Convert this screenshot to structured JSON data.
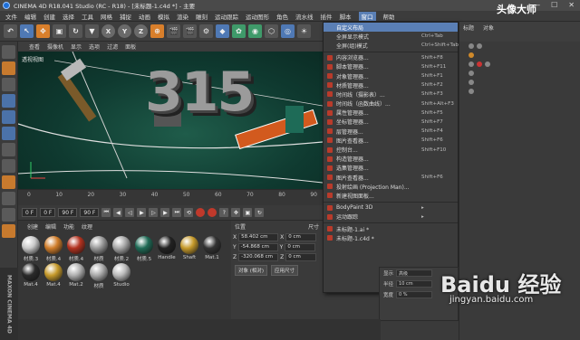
{
  "titlebar": {
    "title": "CINEMA 4D R18.041 Studio (RC - R18) - [未标题-1.c4d *] - 主要",
    "min": "—",
    "max": "☐",
    "close": "✕"
  },
  "menubar": {
    "items": [
      "文件",
      "编辑",
      "创建",
      "选择",
      "工具",
      "网格",
      "捕捉",
      "动画",
      "模拟",
      "渲染",
      "雕刻",
      "运动跟踪",
      "运动图形",
      "角色",
      "流水线",
      "插件",
      "脚本",
      "窗口",
      "帮助"
    ],
    "active_index": 17
  },
  "toolbar": {
    "axes": [
      "X",
      "Y",
      "Z"
    ]
  },
  "viewport": {
    "menu": [
      "查看",
      "摄像机",
      "显示",
      "选项",
      "过滤",
      "面板"
    ],
    "label": "透视视图",
    "scene_text": "315"
  },
  "timeline": {
    "ticks": [
      "0",
      "10",
      "20",
      "30",
      "40",
      "50",
      "60",
      "70",
      "80",
      "90"
    ]
  },
  "playbar": {
    "start": "0 F",
    "current": "0 F",
    "end": "90 F",
    "end2": "90 F"
  },
  "materials": {
    "menu": [
      "创建",
      "编辑",
      "功能",
      "纹理"
    ],
    "items": [
      {
        "name": "材质.3",
        "color": "#c9c9c9"
      },
      {
        "name": "材质.4",
        "color": "#d07d2a"
      },
      {
        "name": "材质.4",
        "color": "#b3321f"
      },
      {
        "name": "材质",
        "color": "#9a9a9a"
      },
      {
        "name": "材质.2",
        "color": "#a8a8a8"
      },
      {
        "name": "材质.5",
        "color": "#1f6b56"
      },
      {
        "name": "Handle",
        "color": "#222222"
      },
      {
        "name": "Shaft",
        "color": "#c69a2b"
      },
      {
        "name": "Mat.1",
        "color": "#333333"
      },
      {
        "name": "Mat.4",
        "color": "#2a2a2a"
      },
      {
        "name": "Mat.4",
        "color": "#c69a2b"
      },
      {
        "name": "Mat.2",
        "color": "#b0b0b0"
      },
      {
        "name": "材质",
        "color": "#aaaaaa"
      },
      {
        "name": "Studio",
        "color": "#bbbbbb"
      }
    ]
  },
  "coords": {
    "head": [
      "位置",
      "尺寸"
    ],
    "rows": [
      {
        "axis": "X",
        "pos": "58.402 cm",
        "axis2": "X",
        "size": "0 cm"
      },
      {
        "axis": "Y",
        "pos": "-54.868 cm",
        "axis2": "Y",
        "size": "0 cm"
      },
      {
        "axis": "Z",
        "pos": "-320.068 cm",
        "axis2": "Z",
        "size": "0 cm"
      }
    ],
    "mode": "对象 (相对)",
    "apply": "应用尺寸"
  },
  "window_menu": {
    "items": [
      {
        "label": "自定义布局",
        "shortcut": "",
        "highlight": true
      },
      {
        "label": "全屏显示模式",
        "shortcut": "Ctrl+Tab"
      },
      {
        "label": "全屏(组)模式",
        "shortcut": "Ctrl+Shift+Tab"
      },
      {
        "label": "内容浏览器...",
        "shortcut": "Shift+F8"
      },
      {
        "label": "脚本管理器...",
        "shortcut": "Shift+F11"
      },
      {
        "label": "对象管理器...",
        "shortcut": "Shift+F1"
      },
      {
        "label": "材质管理器...",
        "shortcut": "Shift+F2"
      },
      {
        "label": "时间线（摄影表）...",
        "shortcut": "Shift+F3"
      },
      {
        "label": "时间线（函数曲线）...",
        "shortcut": "Shift+Alt+F3"
      },
      {
        "label": "属性管理器...",
        "shortcut": "Shift+F5"
      },
      {
        "label": "坐标管理器...",
        "shortcut": "Shift+F7"
      },
      {
        "label": "层管理器...",
        "shortcut": "Shift+F4"
      },
      {
        "label": "图片查看器...",
        "shortcut": "Shift+F6"
      },
      {
        "label": "控制台...",
        "shortcut": "Shift+F10"
      },
      {
        "label": "构造管理器...",
        "shortcut": ""
      },
      {
        "label": "选集管理器...",
        "shortcut": ""
      },
      {
        "label": "图片查看器...",
        "shortcut": "Shift+F6"
      },
      {
        "label": "投射绘画 (Projection Man)...",
        "shortcut": ""
      },
      {
        "label": "新建视图面板...",
        "shortcut": ""
      },
      {
        "label": "BodyPaint 3D",
        "shortcut": "▸"
      },
      {
        "label": "运动跟踪",
        "shortcut": "▸"
      },
      {
        "label": "未标题-1.ai *",
        "shortcut": ""
      },
      {
        "label": "未标题-1.c4d *",
        "shortcut": ""
      }
    ]
  },
  "right_panel": {
    "header": "标题",
    "tab": "对象"
  },
  "attr_panel": {
    "rows": [
      {
        "label": "显示",
        "value": "高级"
      },
      {
        "label": "半径",
        "value": "10 cm"
      },
      {
        "label": "宽度",
        "value": "0 %"
      }
    ]
  },
  "brand": "MAXON CINEMA 4D",
  "watermark": "Baidu 经验",
  "watermark_url": "jingyan.baidu.com",
  "corner_logo": "头像大师"
}
